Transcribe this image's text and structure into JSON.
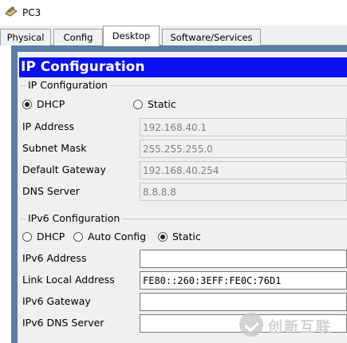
{
  "window": {
    "title": "PC3",
    "icon": "pc-icon"
  },
  "tabs": [
    {
      "label": "Physical",
      "active": false
    },
    {
      "label": "Config",
      "active": false
    },
    {
      "label": "Desktop",
      "active": true
    },
    {
      "label": "Software/Services",
      "active": false
    }
  ],
  "ip_config": {
    "header": "IP Configuration",
    "ipv4_group_title": "IP Configuration",
    "mode_dhcp_label": "DHCP",
    "mode_static_label": "Static",
    "selected_mode": "DHCP",
    "ip_address_label": "IP Address",
    "ip_address_value": "192.168.40.1",
    "subnet_mask_label": "Subnet Mask",
    "subnet_mask_value": "255.255.255.0",
    "default_gateway_label": "Default Gateway",
    "default_gateway_value": "192.168.40.254",
    "dns_server_label": "DNS Server",
    "dns_server_value": "8.8.8.8",
    "ipv6_group_title": "IPv6 Configuration",
    "ipv6_dhcp_label": "DHCP",
    "ipv6_auto_label": "Auto Config",
    "ipv6_static_label": "Static",
    "ipv6_selected_mode": "Static",
    "ipv6_address_label": "IPv6 Address",
    "ipv6_address_value": "",
    "link_local_label": "Link Local Address",
    "link_local_value": "FE80::260:3EFF:FE0C:76D1",
    "ipv6_gateway_label": "IPv6 Gateway",
    "ipv6_gateway_value": "",
    "ipv6_dns_label": "IPv6 DNS Server",
    "ipv6_dns_value": ""
  },
  "watermark": {
    "text": "创新互联"
  },
  "colors": {
    "header_blue": "#0a10ee",
    "frame_border": "#5a7da5",
    "panel_bg": "#f0f0f0"
  }
}
